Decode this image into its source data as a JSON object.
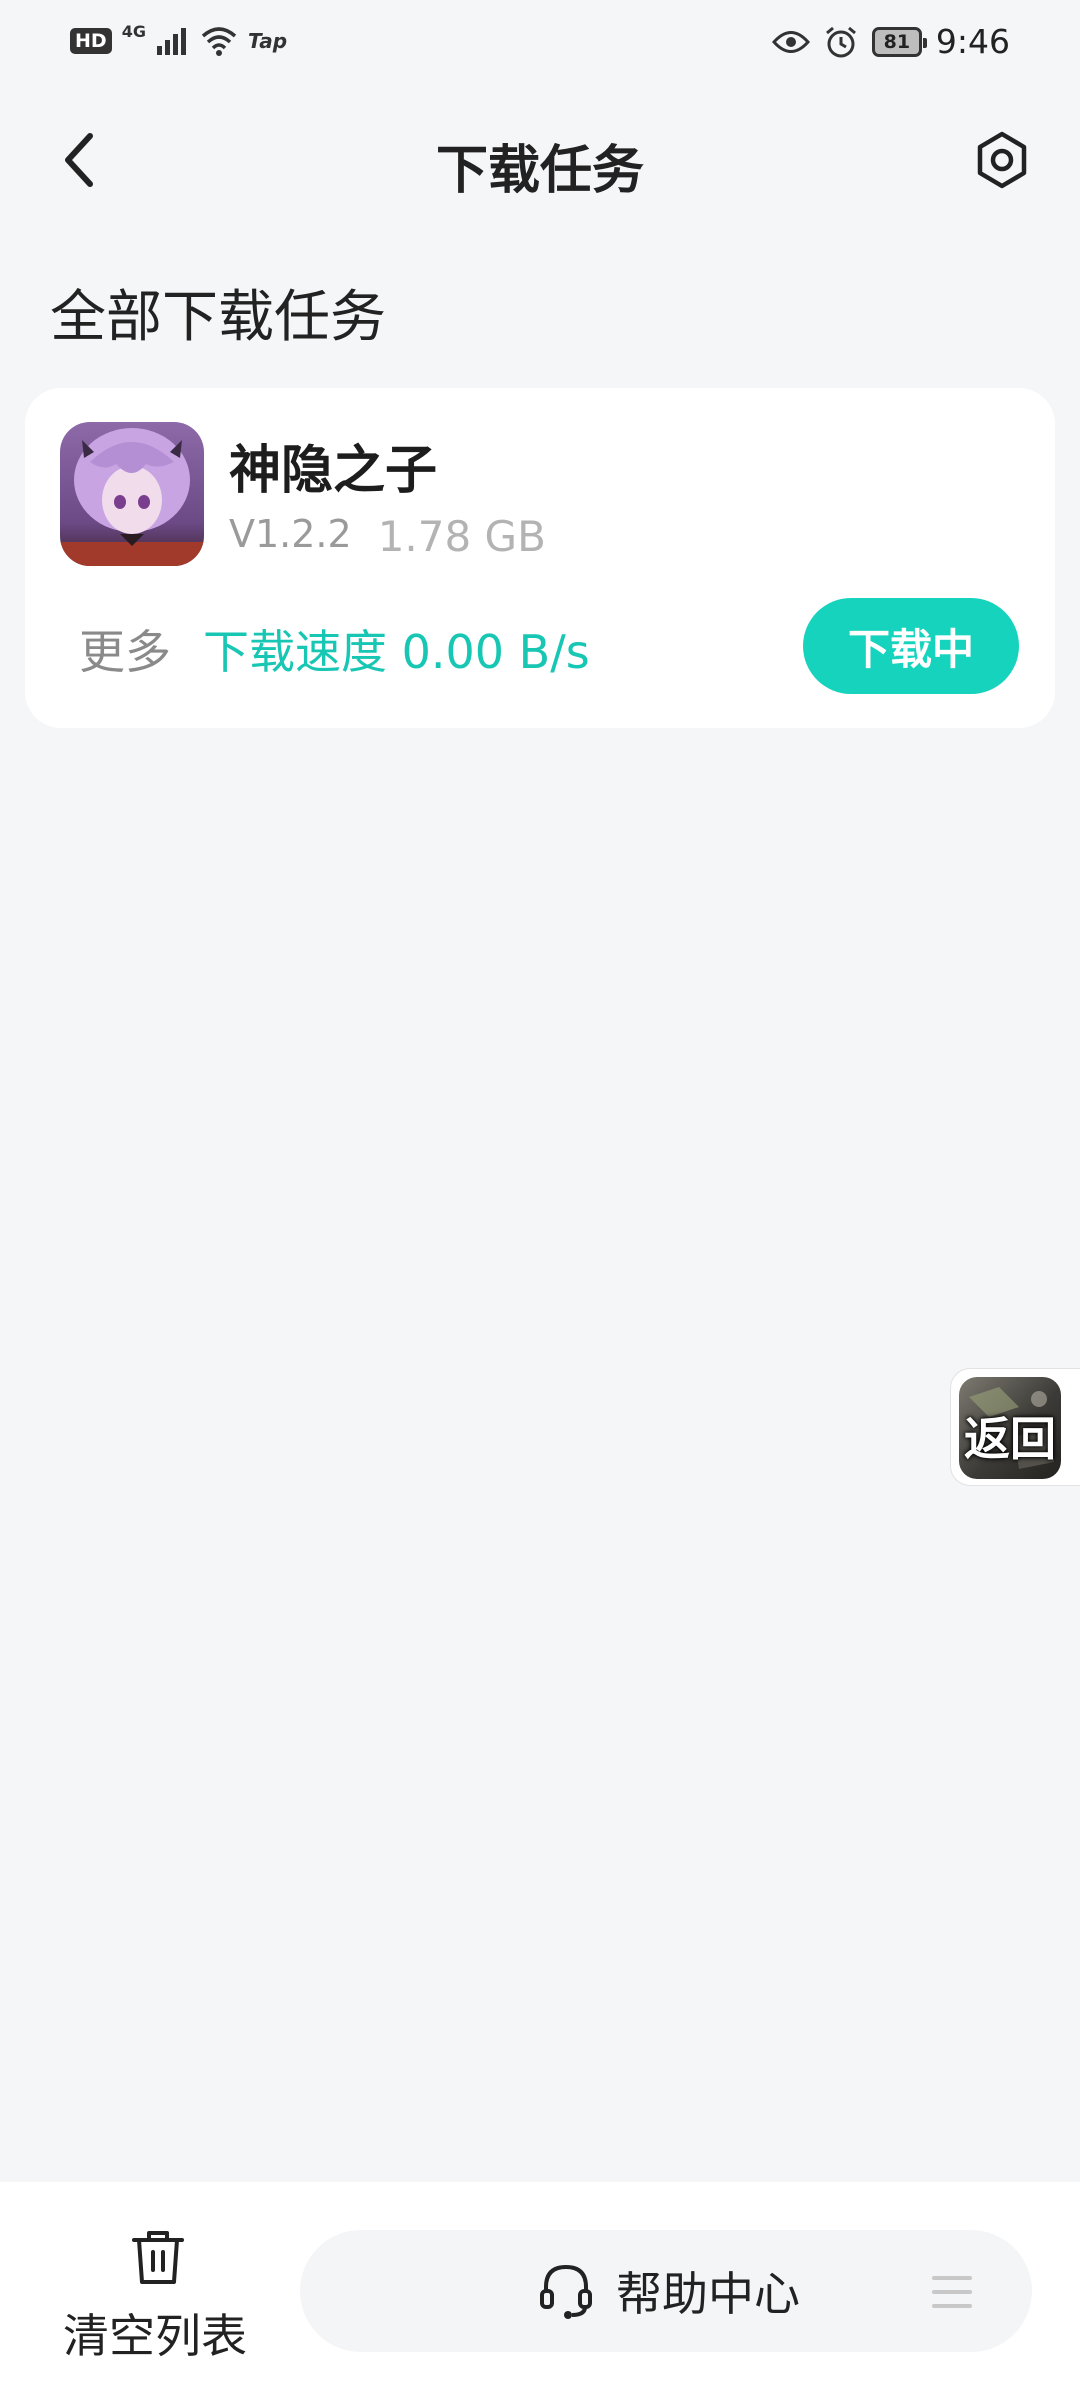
{
  "status_bar": {
    "hd_badge": "HD",
    "network": "4G",
    "tap_label": "Tap",
    "battery": "81",
    "time": "9:46"
  },
  "header": {
    "title": "下载任务"
  },
  "section": {
    "title": "全部下载任务"
  },
  "task": {
    "name": "神隐之子",
    "version": "V1.2.2",
    "size": "1.78 GB",
    "more_label": "更多",
    "speed_label": "下载速度 0.00 B/s",
    "status_label": "下载中"
  },
  "floating": {
    "back_label": "返回"
  },
  "bottom": {
    "clear_label": "清空列表",
    "help_label": "帮助中心"
  },
  "colors": {
    "accent": "#16d3bd",
    "speed_text": "#18c6b4",
    "background": "#f5f6f8"
  }
}
